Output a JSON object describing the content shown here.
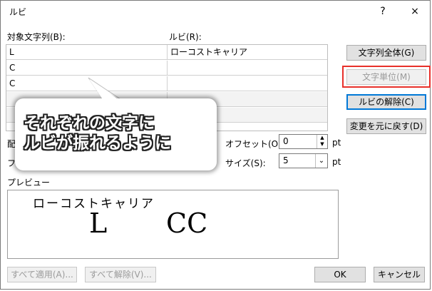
{
  "dialog": {
    "title": "ルビ",
    "help": "?",
    "close": "×"
  },
  "labels": {
    "base_text": "対象文字列(B):",
    "ruby": "ルビ(R):",
    "align_partial": "配",
    "font_partial": "フ",
    "offset": "オフセット(O):",
    "size": "サイズ(S):",
    "pt1": "pt",
    "pt2": "pt",
    "preview": "プレビュー"
  },
  "rows": [
    {
      "base": "L",
      "ruby": "ローコストキャリア"
    },
    {
      "base": "C",
      "ruby": ""
    },
    {
      "base": "C",
      "ruby": ""
    },
    {
      "base": "",
      "ruby": ""
    },
    {
      "base": "",
      "ruby": ""
    }
  ],
  "buttons": {
    "whole_string": "文字列全体(G)",
    "per_char": "文字単位(M)",
    "remove_ruby": "ルビの解除(C)",
    "reset": "変更を元に戻す(D)",
    "apply_all": "すべて適用(A)...",
    "remove_all": "すべて解除(V)...",
    "ok": "OK",
    "cancel": "キャンセル"
  },
  "fields": {
    "offset_value": "0",
    "size_value": "5"
  },
  "preview": {
    "ruby_text": "ローコストキャリア",
    "base_left": "L",
    "base_right": "CC"
  },
  "callout": {
    "line1": "それぞれの文字に",
    "line2": "ルビが振れるように"
  },
  "colors": {
    "highlight": "#e8302a",
    "accent": "#0078d7"
  }
}
